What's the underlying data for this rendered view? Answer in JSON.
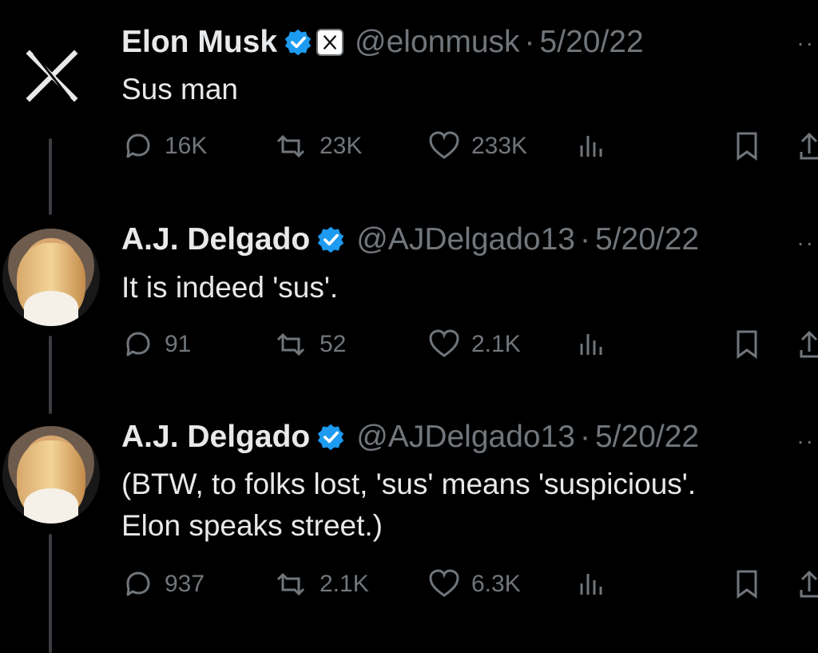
{
  "tweets": [
    {
      "name": "Elon Musk",
      "handle": "@elonmusk",
      "separator": "·",
      "date": "5/20/22",
      "text": "Sus man",
      "replies": "16K",
      "retweets": "23K",
      "likes": "233K",
      "avatar": "x-logo-icon"
    },
    {
      "name": "A.J. Delgado",
      "handle": "@AJDelgado13",
      "separator": "·",
      "date": "5/20/22",
      "text": "It is indeed 'sus'.",
      "replies": "91",
      "retweets": "52",
      "likes": "2.1K",
      "avatar": "profile-photo"
    },
    {
      "name": "A.J. Delgado",
      "handle": "@AJDelgado13",
      "separator": "·",
      "date": "5/20/22",
      "text": "(BTW, to folks lost, 'sus' means 'suspicious'.\nElon speaks street.)",
      "replies": "937",
      "retweets": "2.1K",
      "likes": "6.3K",
      "avatar": "profile-photo"
    }
  ],
  "icons": {
    "verified": "verified-badge-icon",
    "affiliation": "x-affiliation-icon",
    "reply": "reply-icon",
    "retweet": "retweet-icon",
    "like": "heart-icon",
    "views": "views-icon",
    "bookmark": "bookmark-icon",
    "share": "share-icon"
  },
  "colors": {
    "background": "#000000",
    "text": "#e7e9ea",
    "secondary": "#71767b",
    "verified": "#1d9bf0"
  }
}
